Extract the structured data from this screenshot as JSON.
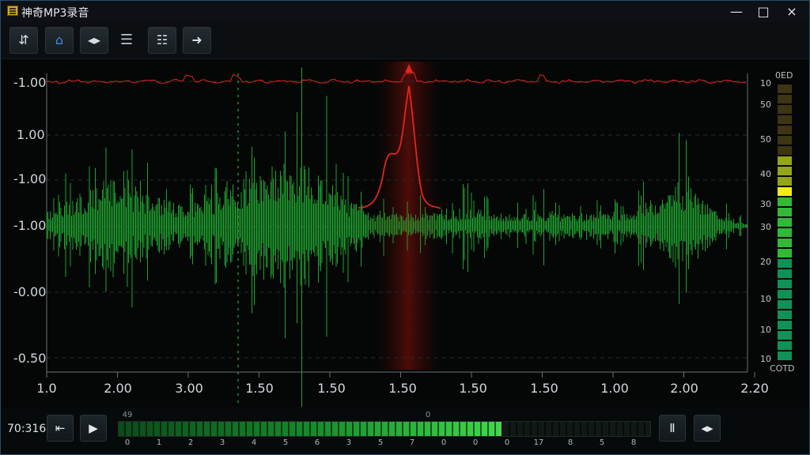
{
  "window": {
    "title": "神奇MP3录音",
    "icons": [
      "app-icon",
      "minimize-icon",
      "maximize-icon",
      "close-icon"
    ]
  },
  "toolbar": {
    "buttons": [
      {
        "name": "tune-button",
        "icon": "sliders-icon",
        "glyph": "⇵"
      },
      {
        "name": "home-button",
        "icon": "home-icon",
        "glyph": "⌂"
      },
      {
        "name": "split-button",
        "icon": "split-arrow-icon",
        "glyph": "◂▸"
      },
      {
        "name": "list-button",
        "icon": "list-lines-icon",
        "glyph": "☰"
      },
      {
        "name": "align-button",
        "icon": "align-left-icon",
        "glyph": "☷"
      },
      {
        "name": "forward-button",
        "icon": "forward-arrow-icon",
        "glyph": "➜"
      }
    ]
  },
  "waveform": {
    "y_labels": [
      "-1.00",
      "1.00",
      "-1.00",
      "-1.00",
      "-0.00",
      "-0.50"
    ],
    "x_labels": [
      "1.0",
      "2.00",
      "3.00",
      "1.50",
      "1.50",
      "1.50",
      "1.50",
      "1.50",
      "1.00",
      "2.00",
      "2.20"
    ],
    "right_labels": [
      "10",
      "50",
      "50",
      "40",
      "30",
      "30",
      "20",
      "10",
      "10",
      "10"
    ],
    "meter_top_label": "0ED",
    "meter_bottom_label": "COTD",
    "colors": {
      "background": "#050707",
      "waveform": "#26a832",
      "peak": "#e1261e",
      "highlight": "#4a0c08",
      "guide": "#1f9a35"
    }
  },
  "transport": {
    "time": "70:316",
    "meter_level": 0.72,
    "meter_top_labels": [
      "49",
      "0"
    ],
    "meter_numbers": [
      "0",
      "1",
      "2",
      "3",
      "4",
      "5",
      "6",
      "3",
      "5",
      "7",
      "0",
      "0",
      "0",
      "17",
      "8",
      "5",
      "8"
    ],
    "icons": [
      "skip-marker-icon",
      "play-icon",
      "pause-icon",
      "volume-icon"
    ]
  }
}
